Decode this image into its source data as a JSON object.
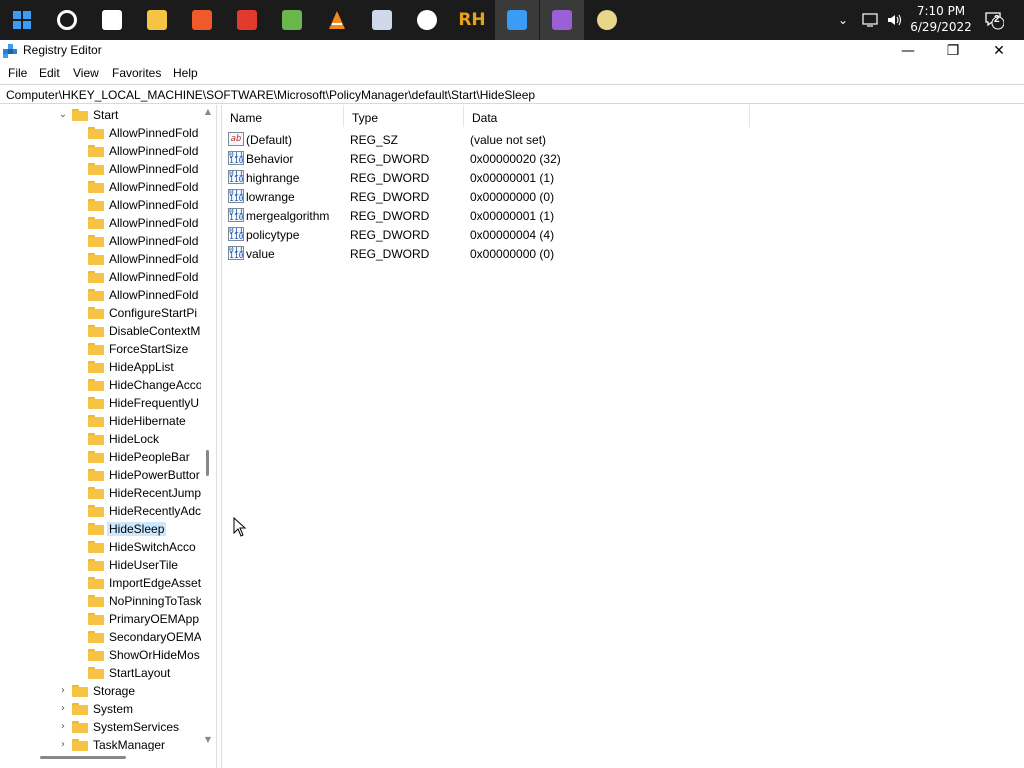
{
  "taskbar": {
    "icons": [
      {
        "name": "start-icon",
        "glyph": "",
        "color": "#3b9cf5"
      },
      {
        "name": "search-icon",
        "glyph": "",
        "color": "#ffffff"
      },
      {
        "name": "task-view-icon",
        "glyph": "",
        "color": "#ffffff"
      },
      {
        "name": "file-explorer-icon",
        "glyph": "",
        "color": "#f6c445"
      },
      {
        "name": "brave-browser-icon",
        "glyph": "",
        "color": "#ef5a2a"
      },
      {
        "name": "ccleaner-icon",
        "glyph": "",
        "color": "#e23b2d"
      },
      {
        "name": "windows-tool-icon",
        "glyph": "",
        "color": "#6bb64a"
      },
      {
        "name": "vlc-icon",
        "glyph": "",
        "color": "#f08a1c"
      },
      {
        "name": "notebook-app-icon",
        "glyph": "",
        "color": "#cfd8e8"
      },
      {
        "name": "inkscape-icon",
        "glyph": "",
        "color": "#ffffff"
      },
      {
        "name": "resource-hacker-icon",
        "glyph": "RH",
        "color": "#e5a31a"
      },
      {
        "name": "registry-editor-icon",
        "glyph": "",
        "color": "#3b9cf5"
      },
      {
        "name": "visual-studio-icon",
        "glyph": "",
        "color": "#9b5fd6"
      },
      {
        "name": "disc-burner-icon",
        "glyph": "",
        "color": "#e8d68a"
      }
    ],
    "time": "7:10 PM",
    "date": "6/29/2022",
    "notification_count": "2"
  },
  "window": {
    "title": "Registry Editor",
    "minimize": "—",
    "maximize": "❐",
    "close": "✕"
  },
  "menu": {
    "file": "File",
    "edit": "Edit",
    "view": "View",
    "favorites": "Favorites",
    "help": "Help"
  },
  "address": {
    "path": "Computer\\HKEY_LOCAL_MACHINE\\SOFTWARE\\Microsoft\\PolicyManager\\default\\Start\\HideSleep"
  },
  "tree": {
    "parent": {
      "label": "Start",
      "expanded": true
    },
    "children": [
      "AllowPinnedFold",
      "AllowPinnedFold",
      "AllowPinnedFold",
      "AllowPinnedFold",
      "AllowPinnedFold",
      "AllowPinnedFold",
      "AllowPinnedFold",
      "AllowPinnedFold",
      "AllowPinnedFold",
      "AllowPinnedFold",
      "ConfigureStartPi",
      "DisableContextM",
      "ForceStartSize",
      "HideAppList",
      "HideChangeAcco",
      "HideFrequentlyU",
      "HideHibernate",
      "HideLock",
      "HidePeopleBar",
      "HidePowerButtor",
      "HideRecentJump",
      "HideRecentlyAdc",
      "HideSleep",
      "HideSwitchAcco",
      "HideUserTile",
      "ImportEdgeAsset",
      "NoPinningToTask",
      "PrimaryOEMApp",
      "SecondaryOEMA",
      "ShowOrHideMos",
      "StartLayout"
    ],
    "selected": "HideSleep",
    "siblings": [
      "Storage",
      "System",
      "SystemServices",
      "TaskManager"
    ]
  },
  "list": {
    "columns": {
      "name": "Name",
      "type": "Type",
      "data": "Data"
    },
    "rows": [
      {
        "name": "(Default)",
        "type": "REG_SZ",
        "data": "(value not set)",
        "icon": "string-value-icon"
      },
      {
        "name": "Behavior",
        "type": "REG_DWORD",
        "data": "0x00000020 (32)",
        "icon": "binary-value-icon"
      },
      {
        "name": "highrange",
        "type": "REG_DWORD",
        "data": "0x00000001 (1)",
        "icon": "binary-value-icon"
      },
      {
        "name": "lowrange",
        "type": "REG_DWORD",
        "data": "0x00000000 (0)",
        "icon": "binary-value-icon"
      },
      {
        "name": "mergealgorithm",
        "type": "REG_DWORD",
        "data": "0x00000001 (1)",
        "icon": "binary-value-icon"
      },
      {
        "name": "policytype",
        "type": "REG_DWORD",
        "data": "0x00000004 (4)",
        "icon": "binary-value-icon"
      },
      {
        "name": "value",
        "type": "REG_DWORD",
        "data": "0x00000000 (0)",
        "icon": "binary-value-icon"
      }
    ]
  },
  "colors": {
    "taskbar_bg": "#1b1b1b",
    "selection": "#cce8ff",
    "folder": "#f6c445"
  }
}
